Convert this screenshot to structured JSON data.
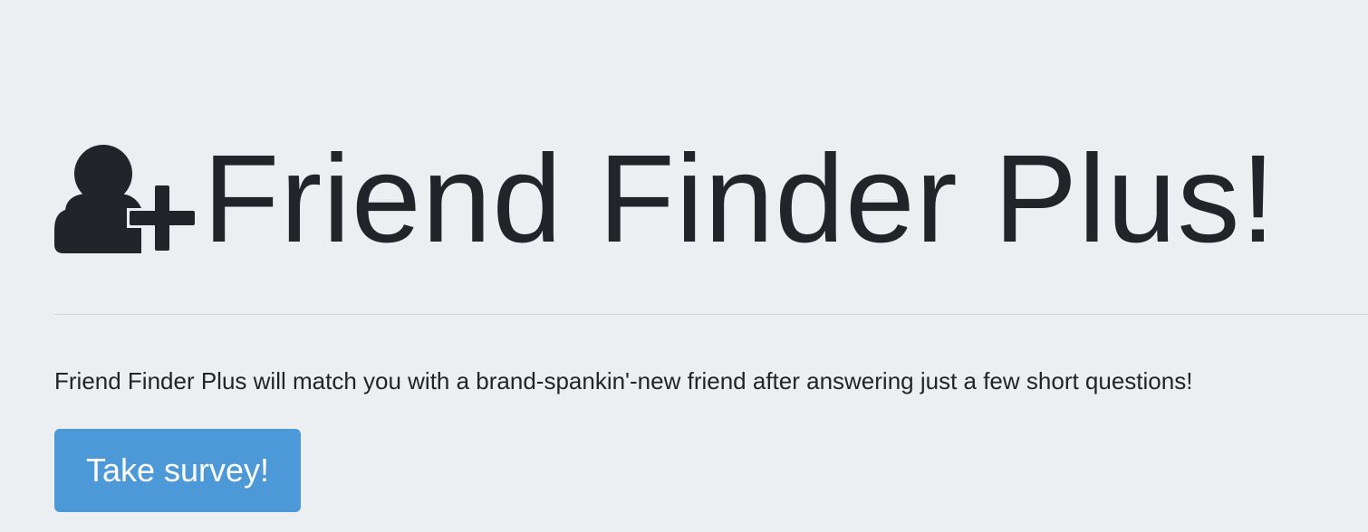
{
  "header": {
    "title": "Friend Finder Plus!",
    "icon": "user-plus-icon"
  },
  "intro": {
    "text": "Friend Finder Plus will match you with a brand-spankin'-new friend after answering just a few short questions!"
  },
  "actions": {
    "survey_button_label": "Take survey!"
  },
  "colors": {
    "background": "#eceff1",
    "text": "#212529",
    "button": "#4d98d6",
    "divider": "#d3d6d9"
  }
}
